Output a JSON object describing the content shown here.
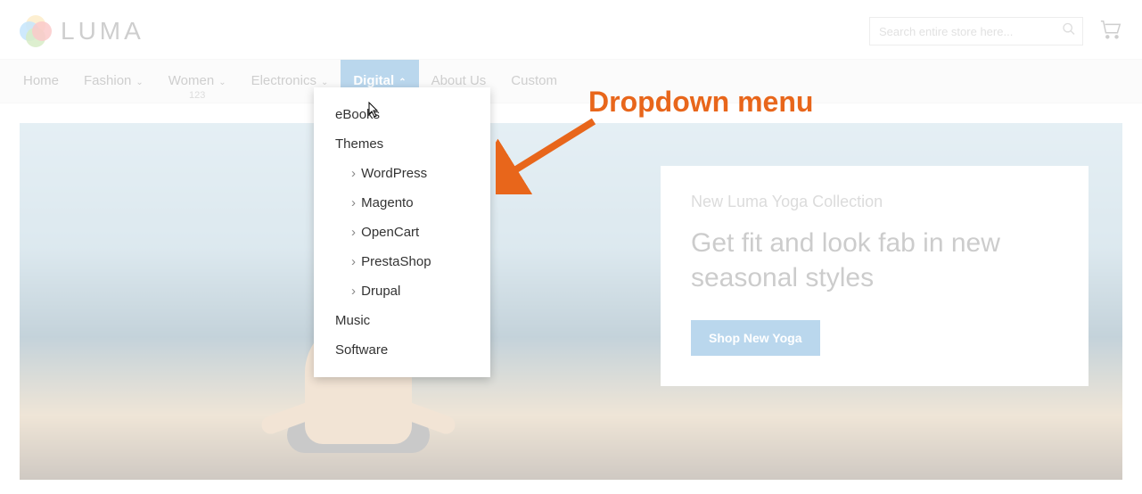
{
  "brand": {
    "name": "LUMA"
  },
  "search": {
    "placeholder": "Search entire store here..."
  },
  "nav": {
    "items": [
      {
        "label": "Home",
        "has_children": false
      },
      {
        "label": "Fashion",
        "has_children": true
      },
      {
        "label": "Women",
        "has_children": true,
        "subtext": "123"
      },
      {
        "label": "Electronics",
        "has_children": true
      },
      {
        "label": "Digital",
        "has_children": true,
        "active": true
      },
      {
        "label": "About Us",
        "has_children": false
      },
      {
        "label": "Custom",
        "has_children": false
      }
    ]
  },
  "dropdown": {
    "items": [
      {
        "label": "eBooks"
      },
      {
        "label": "Themes",
        "children": [
          {
            "label": "WordPress"
          },
          {
            "label": "Magento"
          },
          {
            "label": "OpenCart"
          },
          {
            "label": "PrestaShop"
          },
          {
            "label": "Drupal"
          }
        ]
      },
      {
        "label": "Music"
      },
      {
        "label": "Software"
      }
    ]
  },
  "promo": {
    "subheading": "New Luma Yoga Collection",
    "heading": "Get fit and look fab in new seasonal styles",
    "cta": "Shop New Yoga"
  },
  "annotation": {
    "label": "Dropdown menu"
  }
}
